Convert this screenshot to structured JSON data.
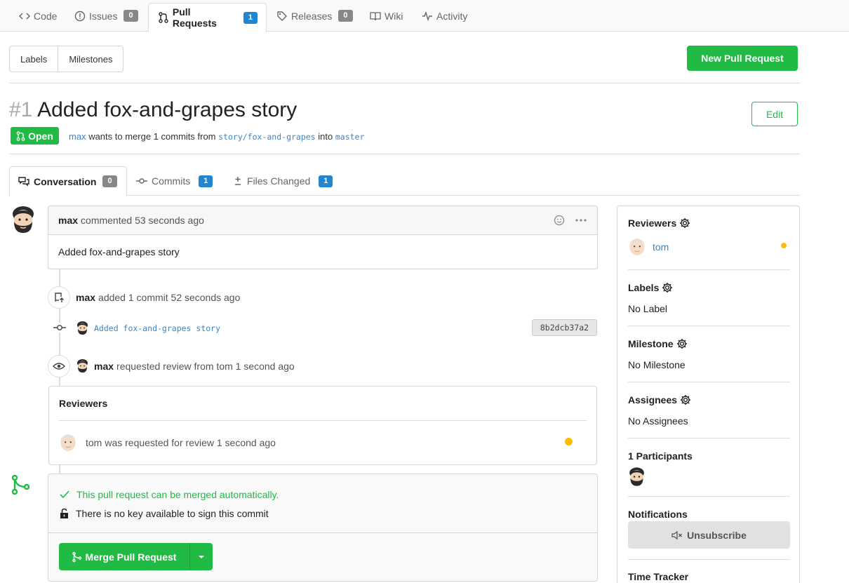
{
  "nav": {
    "tabs": [
      {
        "label": "Code",
        "icon": "code-icon"
      },
      {
        "label": "Issues",
        "icon": "issue-icon",
        "count": "0"
      },
      {
        "label": "Pull Requests",
        "icon": "pull-request-icon",
        "count": "1",
        "active": true
      },
      {
        "label": "Releases",
        "icon": "tag-icon",
        "count": "0"
      },
      {
        "label": "Wiki",
        "icon": "book-icon"
      },
      {
        "label": "Activity",
        "icon": "pulse-icon"
      }
    ]
  },
  "toolbar": {
    "labels": "Labels",
    "milestones": "Milestones",
    "new_pr": "New Pull Request"
  },
  "pr": {
    "number": "#1",
    "title": "Added fox-and-grapes story",
    "edit": "Edit",
    "state": "Open",
    "author": "max",
    "merge_text_1": "wants to merge 1 commits from",
    "head_branch": "story/fox-and-grapes",
    "merge_text_2": "into",
    "base_branch": "master"
  },
  "tabs": [
    {
      "label": "Conversation",
      "count": "0",
      "icon": "comment-discussion-icon"
    },
    {
      "label": "Commits",
      "count": "1",
      "icon": "commit-icon"
    },
    {
      "label": "Files Changed",
      "count": "1",
      "icon": "diff-icon"
    }
  ],
  "comment": {
    "author": "max",
    "meta": "commented 53 seconds ago",
    "body": "Added fox-and-grapes story"
  },
  "events": {
    "commit_event_user": "max",
    "commit_event_text": "added 1 commit 52 seconds ago",
    "commit_message": "Added fox-and-grapes story",
    "commit_sha": "8b2dcb37a2",
    "review_event_user": "max",
    "review_event_text": "requested review from tom 1 second ago"
  },
  "reviewers_box": {
    "title": "Reviewers",
    "user": "tom",
    "text": "was requested for review 1 second ago",
    "status_color": "#fbbd08"
  },
  "merge": {
    "ok_text": "This pull request can be merged automatically.",
    "key_text": "There is no key available to sign this commit",
    "button": "Merge Pull Request"
  },
  "sidebar": {
    "reviewers_title": "Reviewers",
    "reviewer": "tom",
    "labels_title": "Labels",
    "labels_value": "No Label",
    "milestone_title": "Milestone",
    "milestone_value": "No Milestone",
    "assignees_title": "Assignees",
    "assignees_value": "No Assignees",
    "participants_title": "1 Participants",
    "notifications_title": "Notifications",
    "unsubscribe": "Unsubscribe",
    "time_tracker_title": "Time Tracker"
  },
  "colors": {
    "green": "#21ba45",
    "blue": "#2185d0",
    "link": "#4183c4",
    "pending": "#fbbd08"
  }
}
